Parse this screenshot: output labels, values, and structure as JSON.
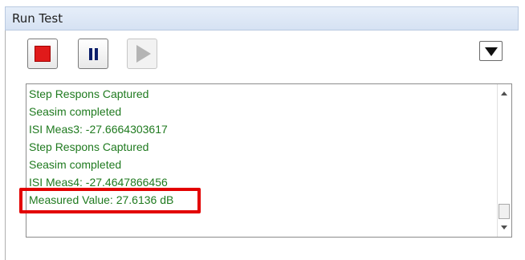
{
  "window": {
    "title": "Run Test"
  },
  "toolbar": {
    "stop_icon": "stop-icon",
    "pause_icon": "pause-icon",
    "play_icon": "play-icon",
    "menu_icon": "dropdown-triangle-icon"
  },
  "log": {
    "lines": [
      "Step Respons Captured",
      "Seasim completed",
      "ISI Meas3: -27.6664303617",
      "Step Respons Captured",
      "Seasim completed",
      "ISI Meas4: -27.4647866456",
      "Measured Value: 27.6136 dB"
    ]
  },
  "colors": {
    "log_text": "#1f7a1f",
    "highlight": "#e30000",
    "stop": "#e01a1a",
    "pause": "#0b1e6a"
  }
}
